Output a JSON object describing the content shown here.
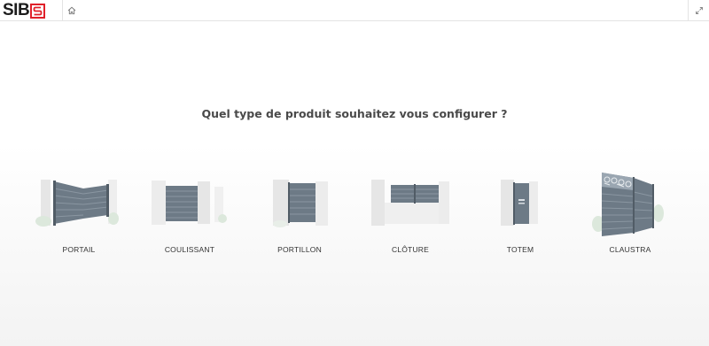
{
  "header": {
    "logo_text": "SIB",
    "logo_letter": "S",
    "brand_color": "#e0202a",
    "home_icon": "home-icon",
    "expand_icon": "expand-icon"
  },
  "main": {
    "question": "Quel type de produit souhaitez vous configurer ?",
    "products": [
      {
        "label": "PORTAIL"
      },
      {
        "label": "COULISSANT"
      },
      {
        "label": "PORTILLON"
      },
      {
        "label": "CLÔTURE"
      },
      {
        "label": "TOTEM"
      },
      {
        "label": "CLAUSTRA"
      }
    ],
    "panel_color": "#6d7a86"
  }
}
